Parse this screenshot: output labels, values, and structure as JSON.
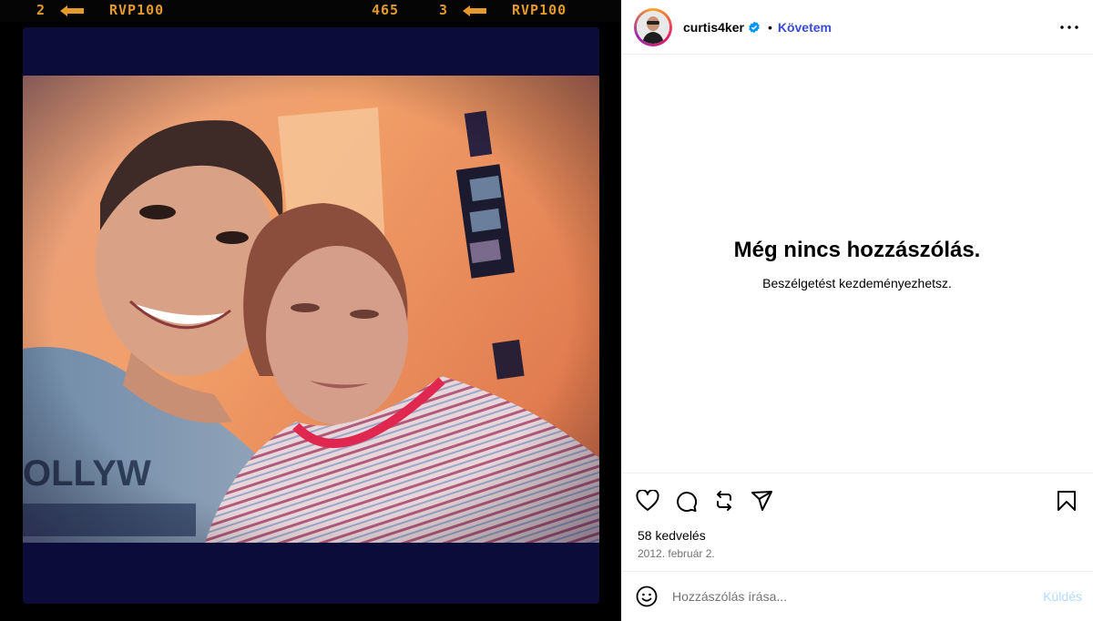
{
  "film": {
    "left_frame": "2",
    "left_code": "RVP100",
    "middle_number": "465",
    "right_frame": "3",
    "right_code": "RVP100"
  },
  "post": {
    "username": "curtis4ker",
    "separator": "•",
    "follow_label": "Követem",
    "likes": "58 kedvelés",
    "date": "2012. február 2."
  },
  "comments": {
    "empty_title": "Még nincs hozzászólás.",
    "empty_subtitle": "Beszélgetést kezdeményezhetsz."
  },
  "comment_box": {
    "placeholder": "Hozzászólás írása...",
    "send_label": "Küldés"
  },
  "icons": {
    "more": "more-options-icon",
    "like": "heart-icon",
    "comment": "comment-bubble-icon",
    "repost": "repost-icon",
    "share": "send-paper-plane-icon",
    "save": "bookmark-icon",
    "emoji": "emoji-smiley-icon",
    "verified": "verified-badge-icon"
  },
  "colors": {
    "film_text": "#e39a2a",
    "follow": "#3a4bd8",
    "send_disabled": "#b3dbff",
    "verified": "#0095f6"
  }
}
